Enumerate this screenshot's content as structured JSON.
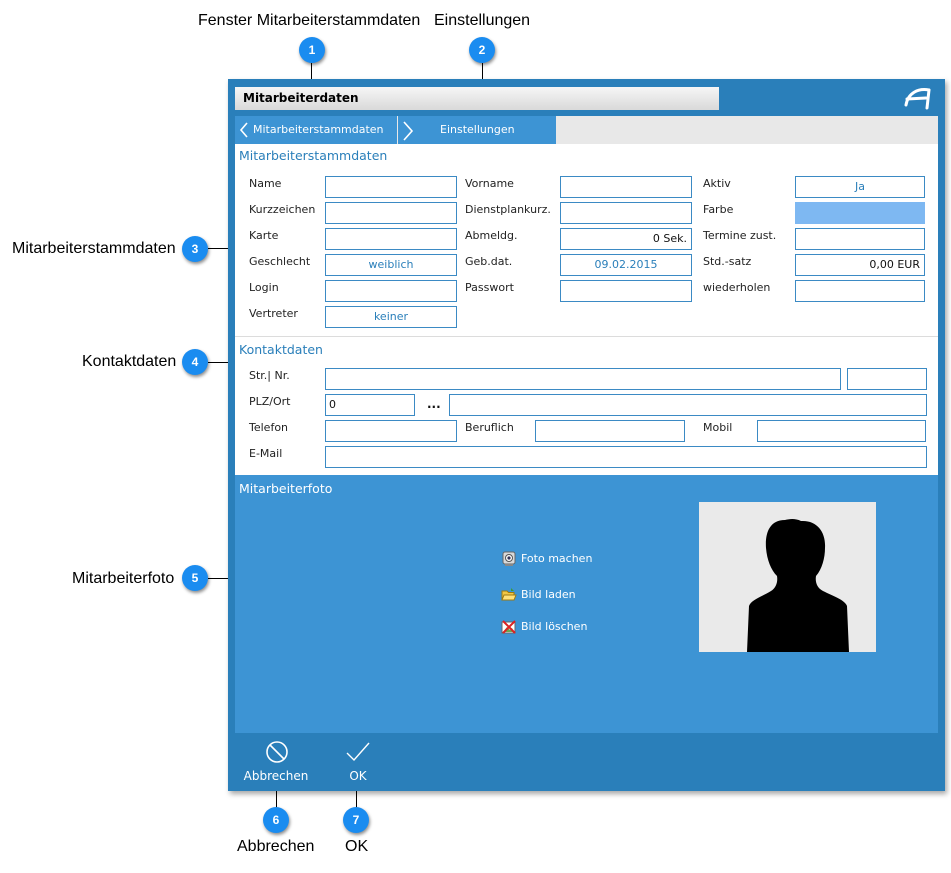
{
  "callouts": {
    "c1": {
      "number": "1",
      "label": "Fenster Mitarbeiterstammdaten"
    },
    "c2": {
      "number": "2",
      "label": "Einstellungen"
    },
    "c3": {
      "number": "3",
      "label": "Mitarbeiterstammdaten"
    },
    "c4": {
      "number": "4",
      "label": "Kontaktdaten"
    },
    "c5": {
      "number": "5",
      "label": "Mitarbeiterfoto"
    },
    "c6": {
      "number": "6",
      "label": "Abbrechen"
    },
    "c7": {
      "number": "7",
      "label": "OK"
    }
  },
  "window": {
    "title": "Mitarbeiterdaten",
    "logo_icon": "app-logo-icon",
    "accent_color": "#2a7fba"
  },
  "tabs": {
    "back": {
      "label": "Mitarbeiterstammdaten",
      "icon": "chevron-left-icon"
    },
    "forward": {
      "label": "Einstellungen",
      "icon": "chevron-right-icon"
    }
  },
  "stamm": {
    "title": "Mitarbeiterstammdaten",
    "name": {
      "label": "Name",
      "value": ""
    },
    "kurzzeichen": {
      "label": "Kurzzeichen",
      "value": ""
    },
    "karte": {
      "label": "Karte",
      "value": ""
    },
    "geschlecht": {
      "label": "Geschlecht",
      "value": "weiblich"
    },
    "login": {
      "label": "Login",
      "value": ""
    },
    "vertreter": {
      "label": "Vertreter",
      "value": "keiner"
    },
    "vorname": {
      "label": "Vorname",
      "value": ""
    },
    "dienstplankurz": {
      "label": "Dienstplankurz.",
      "value": ""
    },
    "abmeldg": {
      "label": "Abmeldg.",
      "value": "0 Sek."
    },
    "gebdat": {
      "label": "Geb.dat.",
      "value": "09.02.2015"
    },
    "passwort": {
      "label": "Passwort",
      "value": ""
    },
    "aktiv": {
      "label": "Aktiv",
      "value": "Ja"
    },
    "farbe": {
      "label": "Farbe",
      "value": "",
      "color": "#7eb8f2"
    },
    "termine": {
      "label": "Termine zust.",
      "value": ""
    },
    "stdsatz": {
      "label": "Std.-satz",
      "value": "0,00 EUR"
    },
    "wiederholen": {
      "label": "wiederholen",
      "value": ""
    }
  },
  "kontakt": {
    "title": "Kontaktdaten",
    "str": {
      "label": "Str.| Nr.",
      "street": "",
      "number": ""
    },
    "plz": {
      "label": "PLZ/Ort",
      "zip": "0",
      "dots": "...",
      "city": ""
    },
    "telefon": {
      "label": "Telefon",
      "value": ""
    },
    "beruflich": {
      "label": "Beruflich",
      "value": ""
    },
    "mobil": {
      "label": "Mobil",
      "value": ""
    },
    "email": {
      "label": "E-Mail",
      "value": ""
    }
  },
  "foto": {
    "title": "Mitarbeiterfoto",
    "take": {
      "label": "Foto machen",
      "icon": "camera-icon"
    },
    "load": {
      "label": "Bild laden",
      "icon": "folder-open-icon"
    },
    "delete": {
      "label": "Bild löschen",
      "icon": "image-delete-icon"
    },
    "placeholder_icon": "person-silhouette-icon"
  },
  "footer": {
    "cancel": {
      "label": "Abbrechen",
      "icon": "cancel-circle-icon"
    },
    "ok": {
      "label": "OK",
      "icon": "checkmark-icon"
    }
  }
}
